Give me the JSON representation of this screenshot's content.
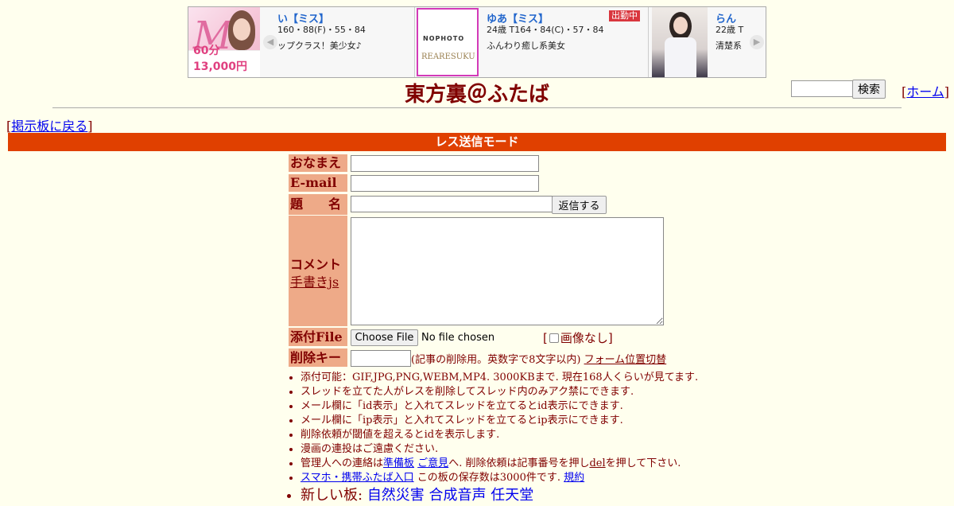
{
  "ad": {
    "left": {
      "letter": "M",
      "price": "60分13,000円"
    },
    "card1": {
      "name": "い【ミス】",
      "spec": "160・88(F)・55・84",
      "desc": "ップクラス！美少女♪"
    },
    "card2": {
      "name": "ゆあ【ミス】",
      "badge": "出勤中",
      "spec": "24歳 T164・84(C)・57・84",
      "desc": "ふんわり癒し系美女",
      "logo1": "NOPHOTO",
      "logo2": "REARESUKU"
    },
    "card3": {
      "name": "らん",
      "spec": "22歳 T",
      "desc": "清楚系"
    }
  },
  "header": {
    "title": "東方裏＠ふたば",
    "search_button": "検索",
    "home_link": "ホーム",
    "back_link": "掲示板に戻る"
  },
  "mode_bar": "レス送信モード",
  "form": {
    "name_label": "おなまえ",
    "email_label": "E-mail",
    "subject_label": "題　　名",
    "submit_button": "返信する",
    "comment_label": "コメント",
    "handwrite_link": "手書きjs",
    "file_label": "添付File",
    "choose_file_button": "Choose File",
    "no_file_text": "No file chosen",
    "no_image_label": "画像なし",
    "delkey_label": "削除キー",
    "delkey_note": "(記事の削除用。英数字で8文字以内)",
    "form_position_link": "フォーム位置切替"
  },
  "notes": {
    "n1": "添付可能：GIF,JPG,PNG,WEBM,MP4. 3000KBまで. 現在168人くらいが見てます.",
    "n2": "スレッドを立てた人がレスを削除してスレッド内のみアク禁にできます.",
    "n3": "メール欄に「id表示」と入れてスレッドを立てるとid表示にできます.",
    "n4": "メール欄に「ip表示」と入れてスレッドを立てるとip表示にできます.",
    "n5": "削除依頼が閾値を超えるとidを表示します.",
    "n6": "漫画の連投はご遠慮ください.",
    "n7_a": "管理人への連絡は",
    "n7_link1": "準備板",
    "n7_link2": "ご意見",
    "n7_b": "へ. 削除依頼は記事番号を押し",
    "n7_link3": "del",
    "n7_c": "を押して下さい.",
    "n8_link1": "スマホ・携帯ふたば入口",
    "n8_b": "この板の保存数は3000件です.",
    "n8_link2": "規約",
    "n9_a": "新しい板:",
    "n9_link1": "自然災害",
    "n9_link2": "合成音声",
    "n9_link3": "任天堂"
  }
}
